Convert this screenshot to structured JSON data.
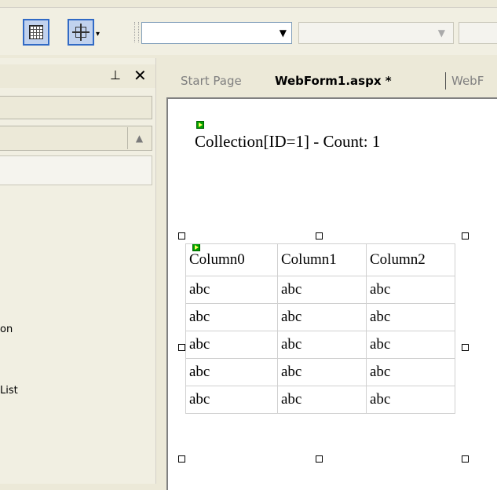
{
  "document_tabs": [
    {
      "label": "Start Page",
      "active": false
    },
    {
      "label": "WebForm1.aspx *",
      "active": true
    },
    {
      "label": "WebF",
      "active": false
    }
  ],
  "left_panel": {
    "pin_icon": "pushpin-icon",
    "close_icon": "close-icon",
    "items": [
      "on",
      "List"
    ]
  },
  "designer": {
    "collection_label": "Collection[ID=1] - Count: 1",
    "grid": {
      "columns": [
        "Column0",
        "Column1",
        "Column2"
      ],
      "rows": [
        [
          "abc",
          "abc",
          "abc"
        ],
        [
          "abc",
          "abc",
          "abc"
        ],
        [
          "abc",
          "abc",
          "abc"
        ],
        [
          "abc",
          "abc",
          "abc"
        ],
        [
          "abc",
          "abc",
          "abc"
        ]
      ]
    }
  },
  "colors": {
    "selection_border": "#316ac5",
    "selection_fill": "#c1d2ee",
    "control_glyph": "#00a000"
  }
}
